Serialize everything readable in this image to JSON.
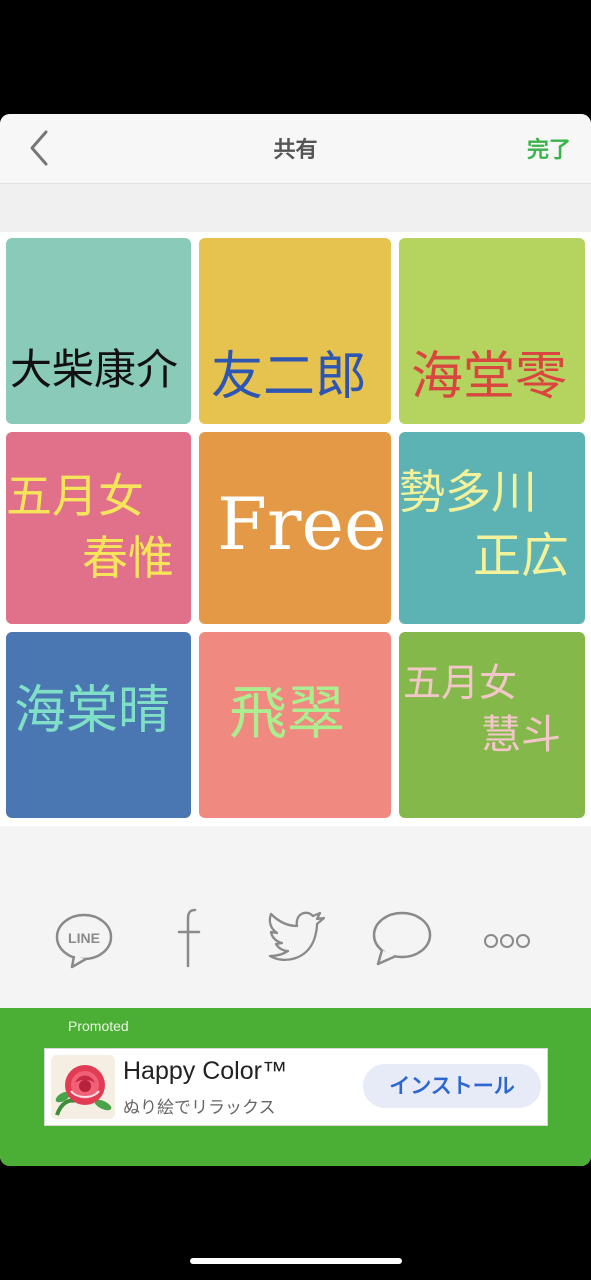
{
  "nav": {
    "title": "共有",
    "done": "完了"
  },
  "tiles": [
    {
      "bg": "#89cbb8",
      "lines": [
        "大柴康介"
      ],
      "color": "#111111"
    },
    {
      "bg": "#e6c24e",
      "lines": [
        "友二郎"
      ],
      "color": "#2d56b3"
    },
    {
      "bg": "#b5d35f",
      "lines": [
        "海堂零"
      ],
      "color": "#d8463f"
    },
    {
      "bg": "#e1708a",
      "lines": [
        "五月女",
        "春惟"
      ],
      "color": "#f6e45a"
    },
    {
      "bg": "#e39945",
      "lines": [
        "Free"
      ],
      "color": "#ffffff"
    },
    {
      "bg": "#5db3b4",
      "lines": [
        "勢多川",
        "正広"
      ],
      "color": "#f3f29a"
    },
    {
      "bg": "#4a77b2",
      "lines": [
        "海棠晴"
      ],
      "color": "#7fe0c7"
    },
    {
      "bg": "#f0897f",
      "lines": [
        "飛翠"
      ],
      "color": "#a9ef8f"
    },
    {
      "bg": "#85b84a",
      "lines": [
        "五月女",
        "慧斗"
      ],
      "color": "#f3c7c9"
    }
  ],
  "share": {
    "line_label": "LINE"
  },
  "ad": {
    "promoted": "Promoted",
    "title": "Happy Color™",
    "subtitle": "ぬり絵でリラックス",
    "install": "インストール"
  }
}
